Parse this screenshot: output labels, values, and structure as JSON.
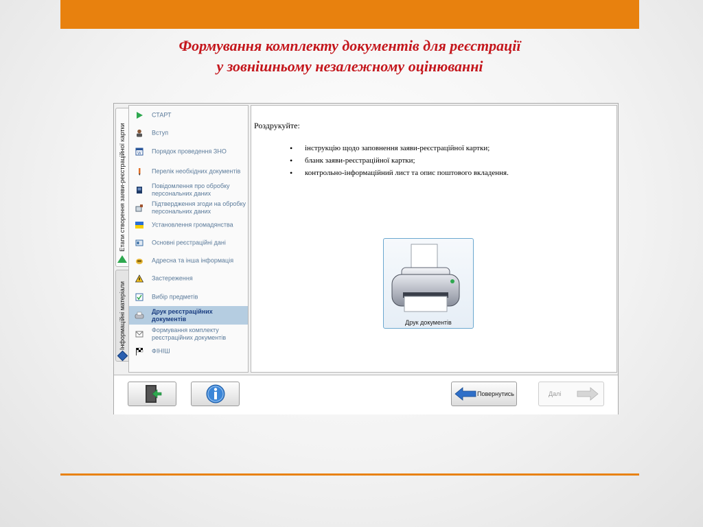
{
  "slide": {
    "title_line1": "Формування комплекту документів для реєстрації",
    "title_line2": "у зовнішньому незалежному оцінюванні",
    "accent_color": "#e8810e",
    "title_color": "#c4161c"
  },
  "tabs": {
    "stages_label": "Етапи створення заяви-реєстраційної картки",
    "info_label": "Інформаційні матеріали"
  },
  "sidebar": {
    "items": [
      {
        "label": "СТАРТ",
        "icon": "play-icon",
        "selected": false
      },
      {
        "label": "Вступ",
        "icon": "person-icon",
        "selected": false
      },
      {
        "label": "Порядок проведення ЗНО",
        "icon": "word-document-icon",
        "selected": false
      },
      {
        "label": "Перелік необхідних документів",
        "icon": "pen-icon",
        "selected": false
      },
      {
        "label": "Повідомлення про обробку персональних даних",
        "icon": "book-icon",
        "selected": false
      },
      {
        "label": "Підтвердження згоди на обробку персональних даних",
        "icon": "stamp-icon",
        "selected": false
      },
      {
        "label": "Установлення громадянства",
        "icon": "ukraine-flag-icon",
        "selected": false
      },
      {
        "label": "Основні реєстраційні дані",
        "icon": "id-card-icon",
        "selected": false
      },
      {
        "label": "Адресна та інша інформація",
        "icon": "address-icon",
        "selected": false
      },
      {
        "label": "Застереження",
        "icon": "warning-icon",
        "selected": false
      },
      {
        "label": "Вибір предметів",
        "icon": "checklist-icon",
        "selected": false
      },
      {
        "label": "Друк реєстраційних документів",
        "icon": "printer-icon",
        "selected": true
      },
      {
        "label": "Формування комплекту реєстраційних документів",
        "icon": "envelope-icon",
        "selected": false
      },
      {
        "label": "ФІНІШ",
        "icon": "finish-flag-icon",
        "selected": false
      }
    ]
  },
  "content": {
    "intro": "Роздрукуйте:",
    "bullets": [
      "інструкцію щодо заповнення заяви-реєстраційної картки;",
      "бланк заяви-реєстраційної картки;",
      "контрольно-інформаційний лист та опис поштового вкладення."
    ],
    "print_button_label": "Друк документів"
  },
  "footer": {
    "exit_icon": "exit-door-icon",
    "info_icon": "info-icon",
    "back_label": "Повернутись",
    "next_label": "Далі"
  }
}
